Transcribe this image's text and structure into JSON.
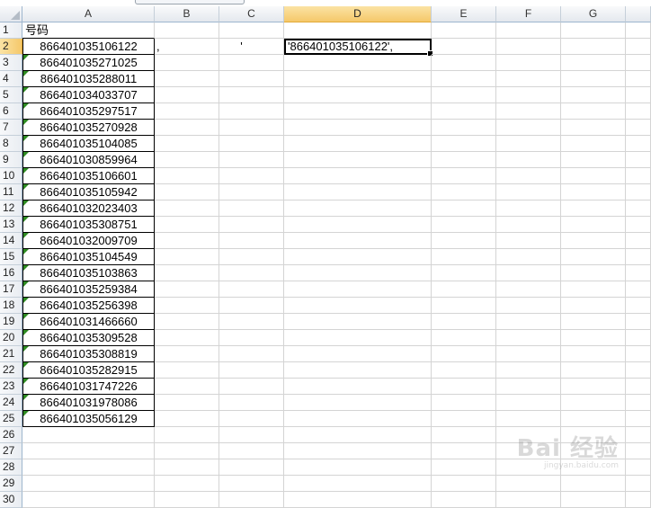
{
  "columns": [
    "A",
    "B",
    "C",
    "D",
    "E",
    "F",
    "G"
  ],
  "selected_column": "D",
  "selected_row": 2,
  "header_cell": "号码",
  "numbers": [
    "866401035106122",
    "866401035271025",
    "866401035288011",
    "866401034033707",
    "866401035297517",
    "866401035270928",
    "866401035104085",
    "866401030859964",
    "866401035106601",
    "866401035105942",
    "866401032023403",
    "866401035308751",
    "866401032009709",
    "866401035104549",
    "866401035103863",
    "866401035259384",
    "866401035256398",
    "866401031466660",
    "866401035309528",
    "866401035308819",
    "866401035282915",
    "866401031747226",
    "866401031978086",
    "866401035056129"
  ],
  "b2": ",",
  "c2": "'",
  "d2": "'866401035106122',",
  "total_rows": 30,
  "watermark": {
    "main": "Bai 经验",
    "sub": "jingyan.baidu.com"
  }
}
